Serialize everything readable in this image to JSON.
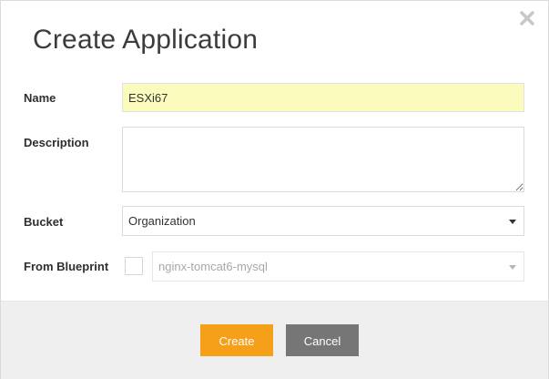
{
  "dialog": {
    "title": "Create Application",
    "close_icon": "close-icon"
  },
  "form": {
    "name": {
      "label": "Name",
      "value": "ESXi67"
    },
    "description": {
      "label": "Description",
      "value": ""
    },
    "bucket": {
      "label": "Bucket",
      "selected": "Organization"
    },
    "from_blueprint": {
      "label": "From Blueprint",
      "checked": false,
      "selected": "nginx-tomcat6-mysql"
    }
  },
  "footer": {
    "create_label": "Create",
    "cancel_label": "Cancel"
  },
  "colors": {
    "create_button": "#f6a01a",
    "cancel_button": "#767676",
    "name_field_bg": "#fbfbbd",
    "footer_bg": "#efefef"
  }
}
